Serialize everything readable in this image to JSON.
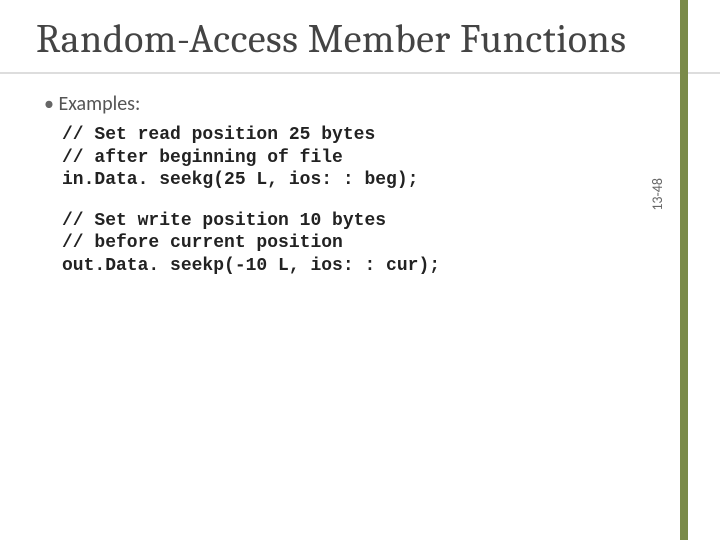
{
  "title": "Random-Access Member Functions",
  "bullet_label": "Examples:",
  "code_block_1": "// Set read position 25 bytes\n// after beginning of file\nin.Data. seekg(25 L, ios: : beg);",
  "code_block_2": "// Set write position 10 bytes\n// before current position\nout.Data. seekp(-10 L, ios: : cur);",
  "page_number": "13-48"
}
